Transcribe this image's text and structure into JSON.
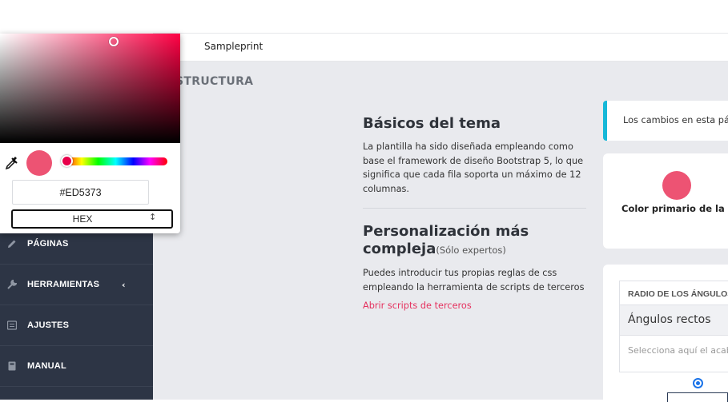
{
  "header": {
    "brand": "Sampleprint"
  },
  "page": {
    "section_title": "STRUCTURA"
  },
  "sidebar": {
    "items": [
      {
        "label": "PÁGINAS",
        "icon": "pencil-icon"
      },
      {
        "label": "HERRAMIENTAS",
        "icon": "wrench-icon",
        "has_submenu": true
      },
      {
        "label": "AJUSTES",
        "icon": "list-icon"
      },
      {
        "label": "MANUAL",
        "icon": "book-icon"
      }
    ]
  },
  "basics": {
    "title": "Básicos del tema",
    "text": "La plantilla ha sido diseñada empleando como base el framework de diseño Bootstrap 5, lo que significa que cada fila soporta un máximo de 12 columnas."
  },
  "custom": {
    "title": "Personalización más compleja",
    "note": "(Sólo expertos)",
    "text": "Puedes introducir tus propias reglas de css empleando la herramienta de scripts de terceros",
    "link": "Abrir scripts de terceros"
  },
  "alert": {
    "text": "Los cambios en esta pág"
  },
  "primary_color": {
    "label": "Color primario de la web",
    "value": "#ED5373"
  },
  "corners": {
    "header": "RADIO DE LOS ÁNGULOS",
    "value": "Ángulos rectos",
    "help": "Selecciona aquí el acab"
  },
  "picker": {
    "hex": "#ED5373",
    "mode": "HEX"
  },
  "colors": {
    "sidebar_bg": "#2d3545",
    "accent": "#e5325f",
    "alert_border": "#16b8d8"
  }
}
